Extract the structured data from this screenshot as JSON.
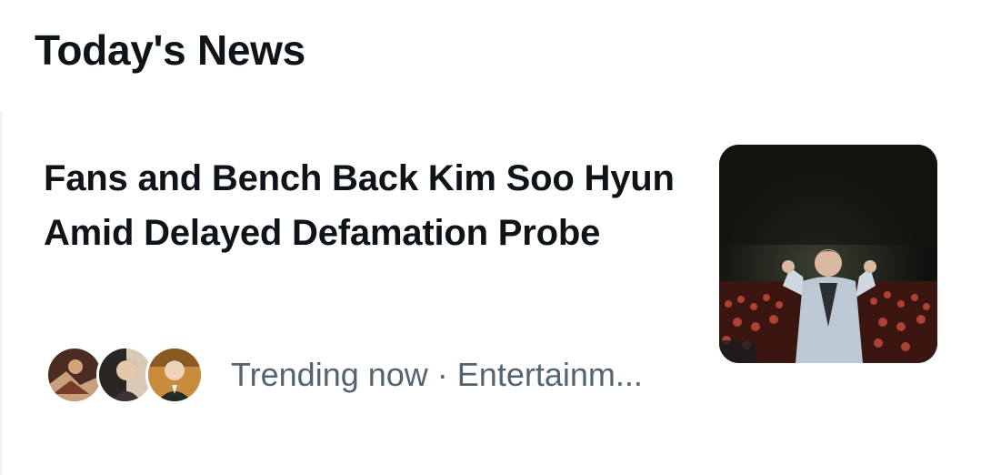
{
  "section": {
    "title": "Today's News"
  },
  "news": {
    "headline": "Fans and Bench Back Kim Soo Hyun Amid Delayed Defamation Probe",
    "meta": "Trending now · Entertainm...",
    "thumbnail_icon": "concert-stage-photo",
    "avatar_icons": [
      "avatar-photo-1",
      "avatar-photo-2",
      "avatar-photo-3"
    ]
  },
  "colors": {
    "primary_text": "#0f1419",
    "secondary_text": "#536471",
    "border": "#eff3f4"
  }
}
